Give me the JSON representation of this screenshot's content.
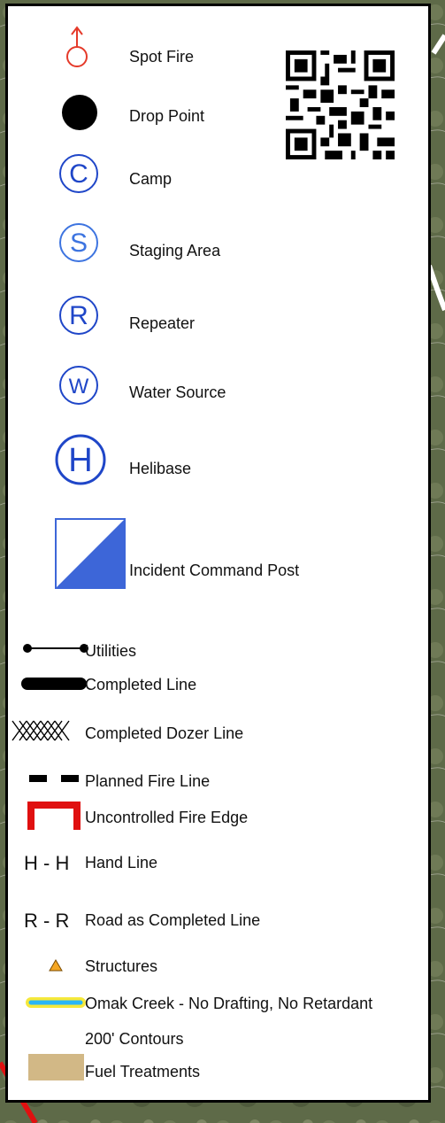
{
  "legend": {
    "items": [
      {
        "id": "spot-fire",
        "label": "Spot Fire",
        "color": "#e53a2a"
      },
      {
        "id": "drop-point",
        "label": "Drop Point",
        "color": "#000000"
      },
      {
        "id": "camp",
        "label": "Camp",
        "color": "#1f46c8",
        "glyph": "C"
      },
      {
        "id": "staging-area",
        "label": "Staging Area",
        "color": "#3d74e0",
        "glyph": "S"
      },
      {
        "id": "repeater",
        "label": "Repeater",
        "color": "#1f46c8",
        "glyph": "R"
      },
      {
        "id": "water-source",
        "label": "Water Source",
        "color": "#1f46c8",
        "glyph": "W"
      },
      {
        "id": "helibase",
        "label": "Helibase",
        "color": "#1f46c8",
        "glyph": "H"
      },
      {
        "id": "icp",
        "label": "Incident Command Post",
        "color": "#3d66d8"
      },
      {
        "id": "utilities",
        "label": "Utilities",
        "color": "#000000"
      },
      {
        "id": "completed-line",
        "label": "Completed Line",
        "color": "#000000"
      },
      {
        "id": "completed-dozer-line",
        "label": "Completed Dozer Line",
        "color": "#000000"
      },
      {
        "id": "planned-fire-line",
        "label": "Planned Fire Line",
        "color": "#000000"
      },
      {
        "id": "uncontrolled-fire-edge",
        "label": "Uncontrolled Fire Edge",
        "color": "#e01010"
      },
      {
        "id": "hand-line",
        "label": "Hand Line",
        "symbol_text": "H - H"
      },
      {
        "id": "road-completed-line",
        "label": "Road as Completed Line",
        "symbol_text": "R - R"
      },
      {
        "id": "structures",
        "label": "Structures",
        "color": "#f5a623"
      },
      {
        "id": "omak-creek",
        "label": "Omak Creek - No Drafting, No Retardant",
        "color": "#29b6f6",
        "outline": "#f5e83b"
      },
      {
        "id": "contours",
        "label": "200' Contours"
      },
      {
        "id": "fuel-treatments",
        "label": "Fuel Treatments",
        "color": "#d2b886"
      }
    ]
  },
  "qr_code": {
    "icon": "qr-code-icon"
  }
}
